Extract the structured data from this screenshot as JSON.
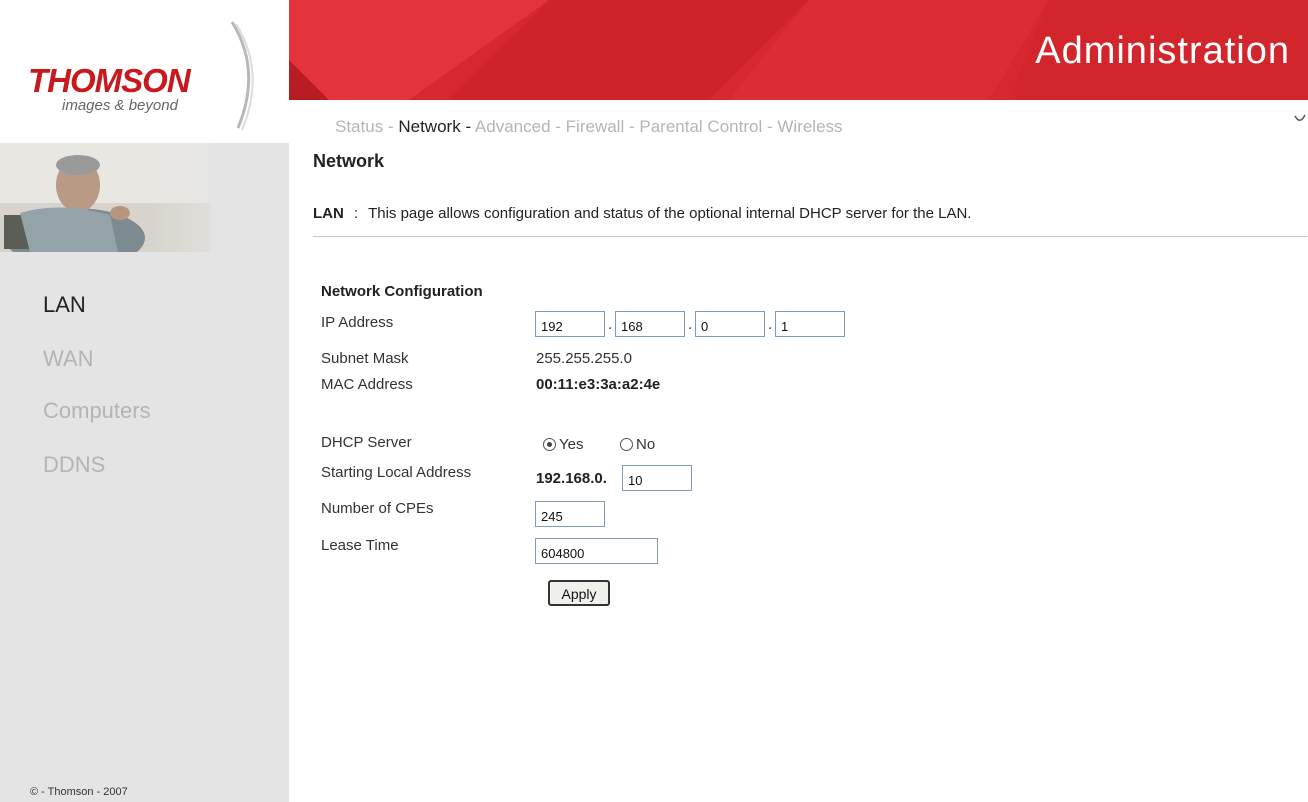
{
  "brand": {
    "logo_text": "THOMSON",
    "tagline": "images & beyond"
  },
  "header": {
    "title": "Administration"
  },
  "nav": {
    "items": [
      "Status",
      "Network",
      "Advanced",
      "Firewall",
      "Parental Control",
      "Wireless"
    ],
    "active": "Network",
    "separator": "-"
  },
  "sidebar": {
    "items": [
      {
        "label": "LAN",
        "active": true
      },
      {
        "label": "WAN",
        "active": false
      },
      {
        "label": "Computers",
        "active": false
      },
      {
        "label": "DDNS",
        "active": false
      }
    ],
    "copyright": "© - Thomson - 2007"
  },
  "page": {
    "title": "Network",
    "intro_key": "LAN",
    "intro_sep": ":",
    "intro_text": "This page allows configuration and status of the optional internal DHCP server for the LAN."
  },
  "network_config": {
    "section_title": "Network Configuration",
    "ip_label": "IP Address",
    "ip": [
      "192",
      "168",
      "0",
      "1"
    ],
    "ip_dot": ".",
    "subnet_label": "Subnet Mask",
    "subnet_value": "255.255.255.0",
    "mac_label": "MAC Address",
    "mac_value": "00:11:e3:3a:a2:4e"
  },
  "dhcp": {
    "server_label": "DHCP Server",
    "yes_label": "Yes",
    "no_label": "No",
    "selected": "Yes",
    "start_label": "Starting Local Address",
    "start_prefix": "192.168.0.",
    "start_value": "10",
    "cpes_label": "Number of CPEs",
    "cpes_value": "245",
    "lease_label": "Lease Time",
    "lease_value": "604800",
    "apply_label": "Apply"
  },
  "colors": {
    "brand_red": "#d7282f",
    "sidebar_bg": "#e4e4e4",
    "inactive_text": "#b4b4b4"
  }
}
